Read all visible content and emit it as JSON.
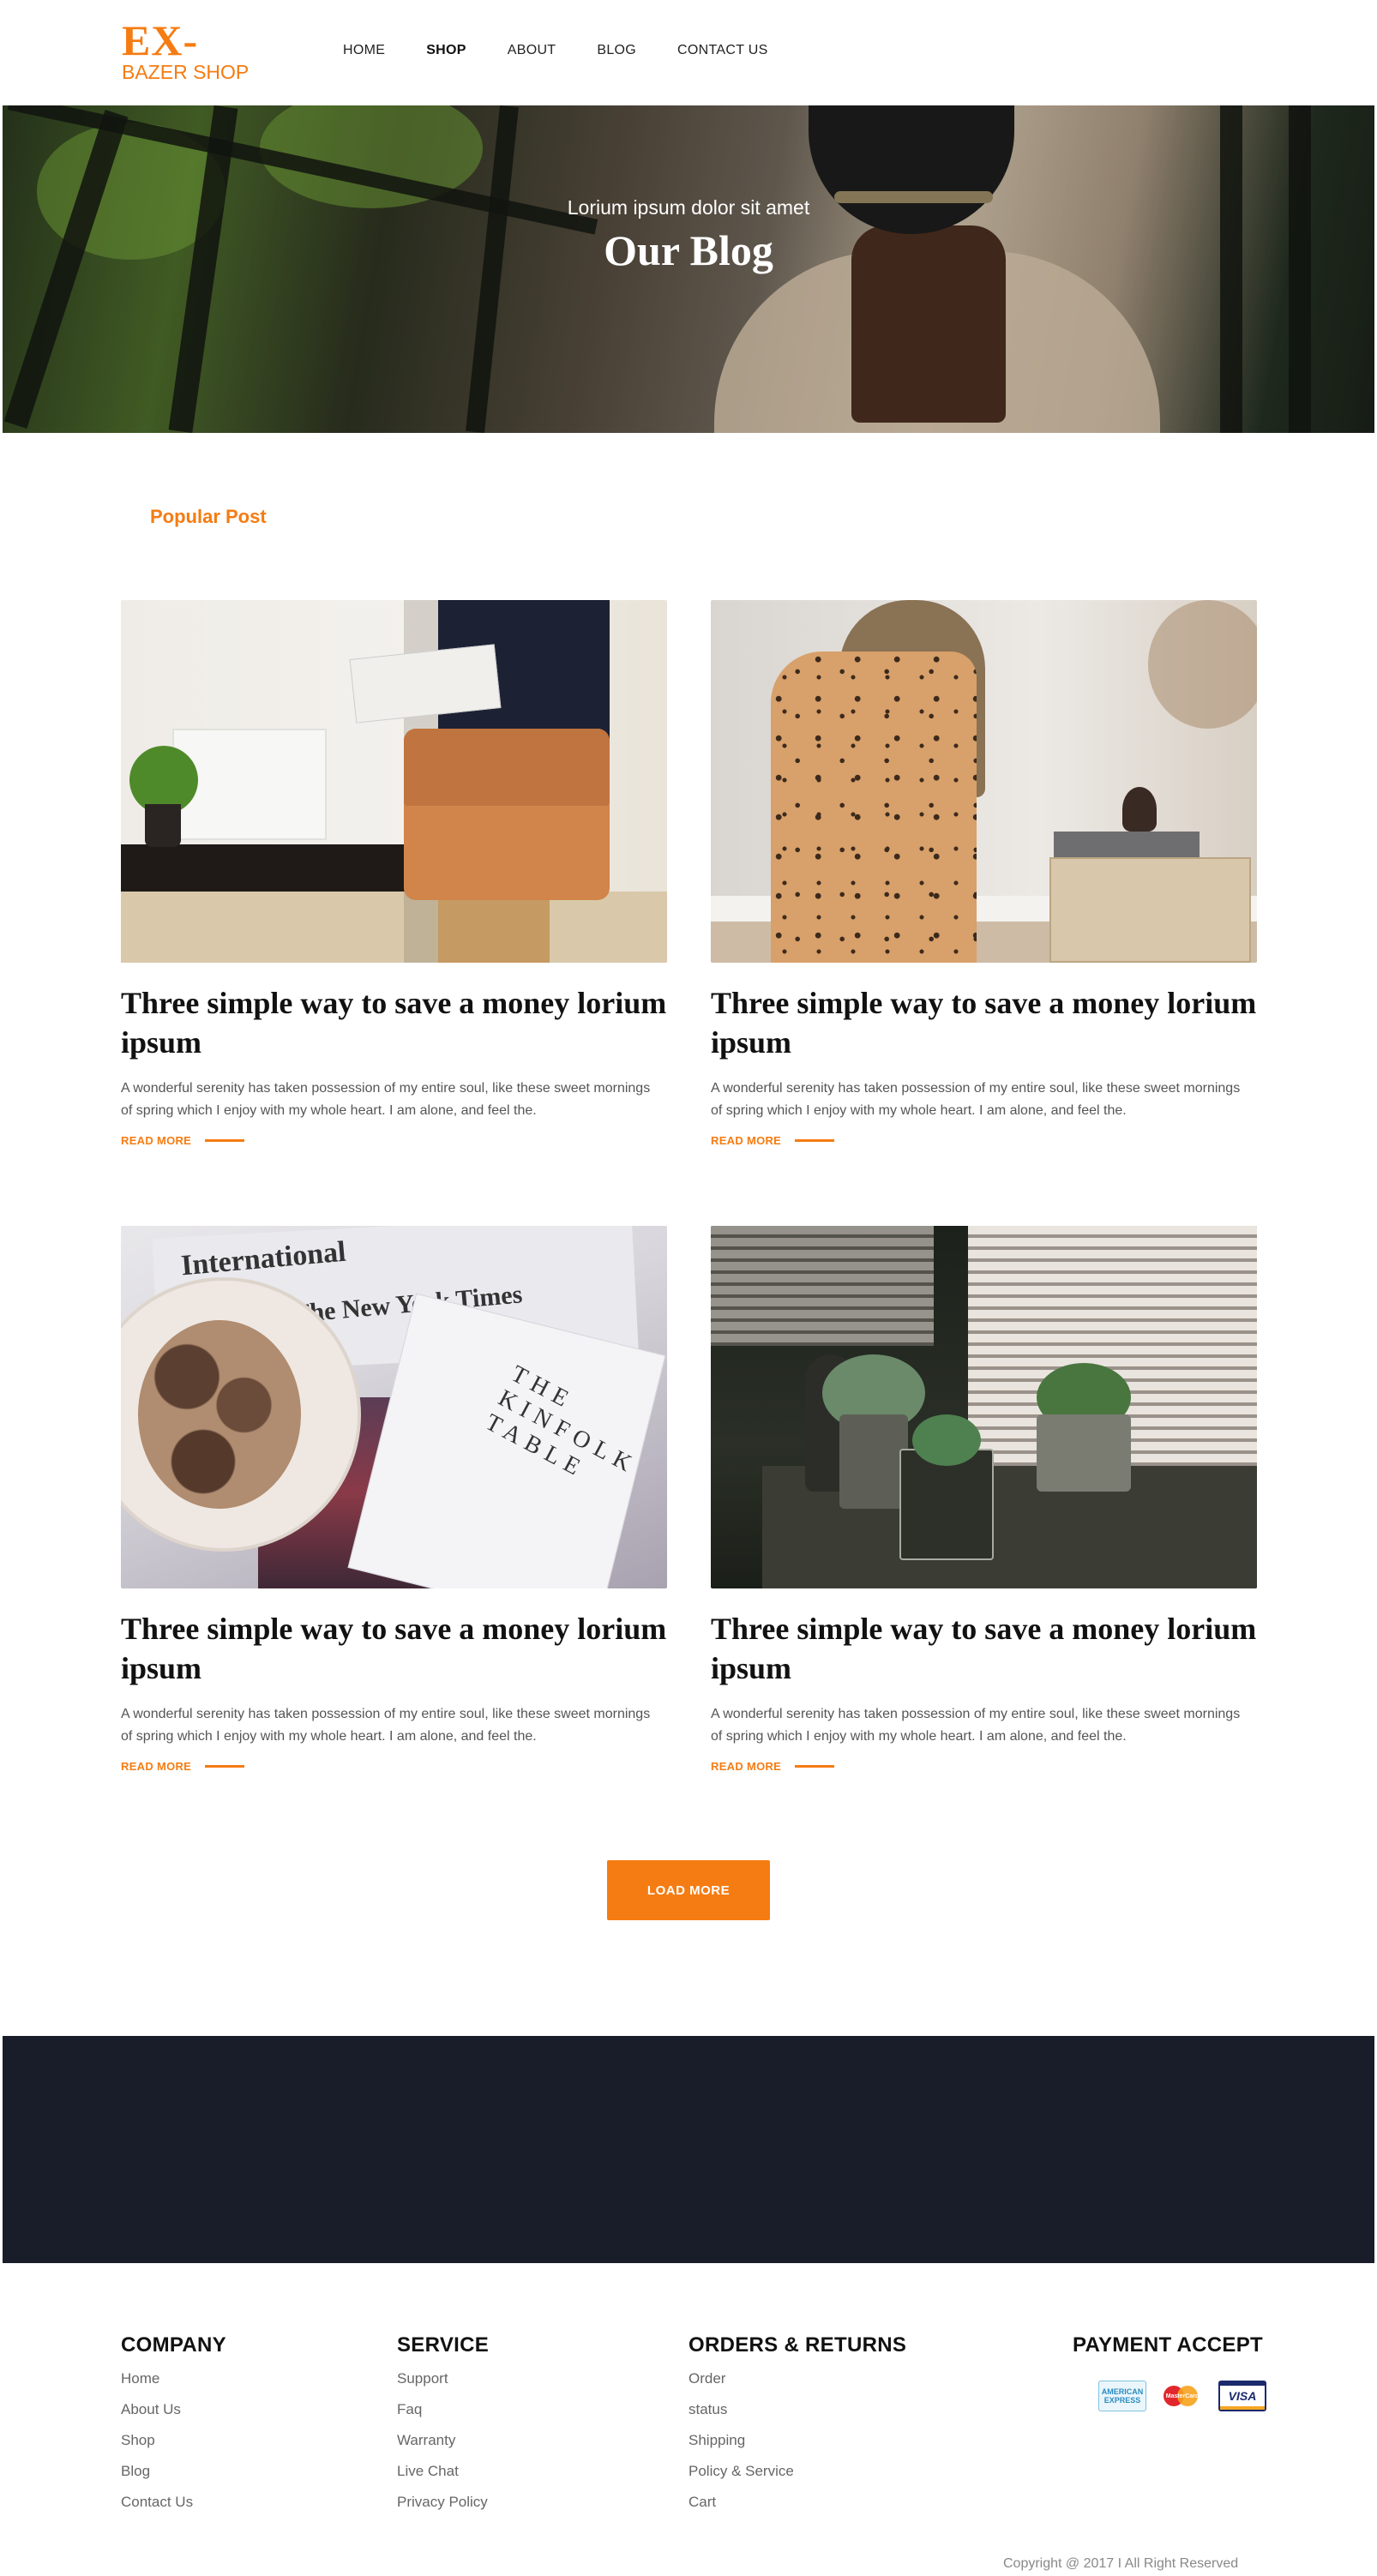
{
  "brand": {
    "logo_top": "EX-",
    "logo_bottom": "BAZER SHOP"
  },
  "nav": [
    {
      "label": "HOME",
      "active": false
    },
    {
      "label": "SHOP",
      "active": true
    },
    {
      "label": "ABOUT",
      "active": false
    },
    {
      "label": "BLOG",
      "active": false
    },
    {
      "label": "CONTACT US",
      "active": false
    }
  ],
  "hero": {
    "subtitle": "Lorium ipsum dolor sit amet",
    "title": "Our Blog"
  },
  "section_label": "Popular Post",
  "posts": [
    {
      "title": "Three simple way to save a money lorium ipsum",
      "text": "A wonderful serenity has taken possession of my entire soul, like these sweet mornings of spring which I enjoy with my whole heart. I am alone, and feel the.",
      "read_more": "READ MORE"
    },
    {
      "title": "Three simple way to save a money lorium ipsum",
      "text": "A wonderful serenity has taken possession of my entire soul, like these sweet mornings of spring which I enjoy with my whole heart. I am alone, and feel the.",
      "read_more": "READ MORE"
    },
    {
      "title": "Three simple way to save a money lorium ipsum",
      "text": "A wonderful serenity has taken possession of my entire soul, like these sweet mornings of spring which I enjoy with my whole heart. I am alone, and feel the.",
      "read_more": "READ MORE"
    },
    {
      "title": "Three simple way to save a money lorium ipsum",
      "text": "A wonderful serenity has taken possession of my entire soul, like these sweet mornings of spring which I enjoy with my whole heart. I am alone, and feel the.",
      "read_more": "READ MORE"
    }
  ],
  "photo_text": {
    "newspaper_1": "International",
    "newspaper_2": "The New York Times",
    "magazine": "THE KINFOLK TABLE"
  },
  "load_more": "LOAD MORE",
  "footer": {
    "company": {
      "heading": "COMPANY",
      "links": [
        "Home",
        "About Us",
        "Shop",
        "Blog",
        "Contact Us"
      ]
    },
    "service": {
      "heading": "SERVICE",
      "links": [
        "Support",
        "Faq",
        "Warranty",
        "Live Chat",
        "Privacy Policy"
      ]
    },
    "orders": {
      "heading": "ORDERS & RETURNS",
      "links": [
        "Order",
        "status",
        "Shipping",
        "Policy & Service",
        "Cart"
      ]
    },
    "payment": {
      "heading": "PAYMENT ACCEPT",
      "cards": [
        {
          "name": "amex-card-icon",
          "label": "AMERICAN EXPRESS"
        },
        {
          "name": "mastercard-icon",
          "label": "MasterCard"
        },
        {
          "name": "visa-card-icon",
          "label": "VISA"
        }
      ]
    },
    "copyright": "Copyright @ 2017 I All Right Reserved"
  },
  "colors": {
    "accent": "#f57c12",
    "dark_band": "#191d29",
    "text_dark": "#111111",
    "text_muted": "#666666"
  }
}
